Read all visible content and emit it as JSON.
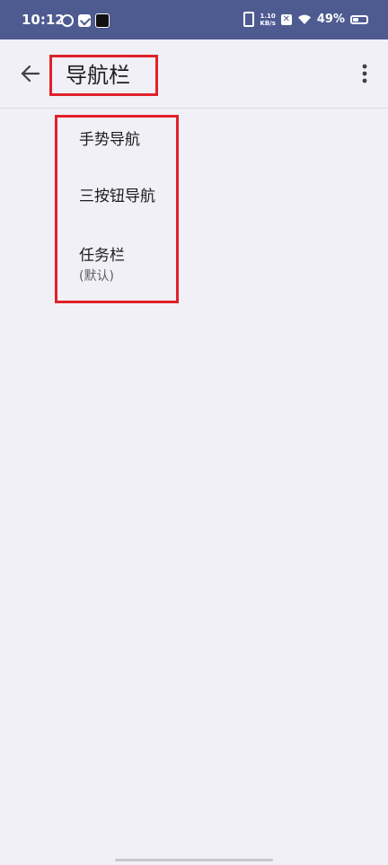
{
  "status_bar": {
    "time": "10:12",
    "net_speed_value": "1.10",
    "net_speed_unit": "KB/s",
    "x_badge": "✕",
    "battery_percent": "49%",
    "battery_level": 0.49
  },
  "app_bar": {
    "title": "导航栏"
  },
  "options": {
    "items": [
      {
        "label": "手势导航"
      },
      {
        "label": "三按钮导航"
      },
      {
        "label": "任务栏",
        "sublabel": "(默认)"
      }
    ]
  },
  "colors": {
    "status_bar_bg": "#4d5b91",
    "page_bg": "#f1f0f6",
    "highlight_border": "#e0212a"
  }
}
